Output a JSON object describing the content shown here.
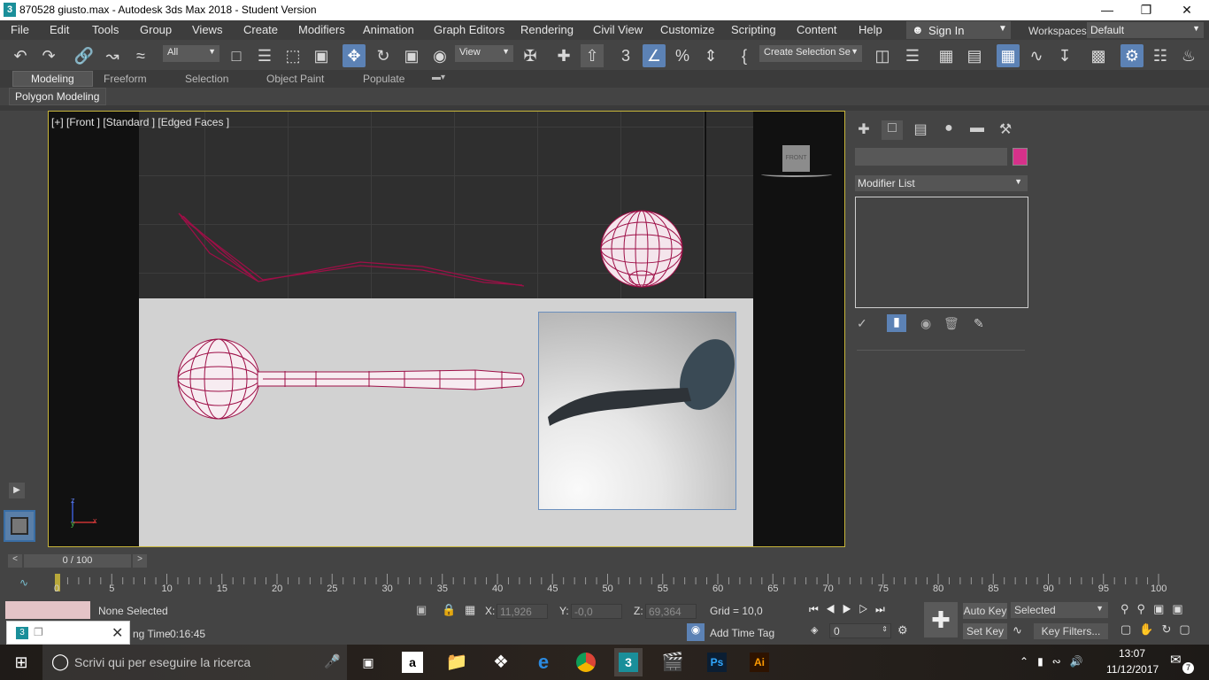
{
  "window": {
    "title": "870528 giusto.max - Autodesk 3ds Max 2018 - Student Version",
    "app_icon": "3",
    "min": "—",
    "restore": "❐",
    "close": "✕"
  },
  "menu": {
    "items": [
      "File",
      "Edit",
      "Tools",
      "Group",
      "Views",
      "Create",
      "Modifiers",
      "Animation",
      "Graph Editors",
      "Rendering",
      "Civil View",
      "Customize",
      "Scripting",
      "Content",
      "Help"
    ],
    "sign_in": "Sign In",
    "workspaces_label": "Workspaces:",
    "workspace_value": "Default"
  },
  "toolbar": {
    "filter_value": "All",
    "refcoord_value": "View",
    "selection_set": "Create Selection Se"
  },
  "ribbon": {
    "tabs": [
      "Modeling",
      "Freeform",
      "Selection",
      "Object Paint",
      "Populate"
    ],
    "sub_panel": "Polygon Modeling"
  },
  "viewport": {
    "label": "[+] [Front ] [Standard ] [Edged Faces ]",
    "viewcube_face": "FRONT",
    "axis_z": "z",
    "axis_x": "x",
    "axis_y": "y",
    "wire_color": "#9e0f47"
  },
  "command_panel": {
    "modifier_list": "Modifier List",
    "object_color": "#d6318a"
  },
  "timeline": {
    "slider_text": "0 / 100",
    "ticks": [
      "0",
      "5",
      "10",
      "15",
      "20",
      "25",
      "30",
      "35",
      "40",
      "45",
      "50",
      "55",
      "60",
      "65",
      "70",
      "75",
      "80",
      "85",
      "90",
      "95",
      "100"
    ]
  },
  "status": {
    "selection": "None Selected",
    "rendering_time_label": "ng Time",
    "rendering_time": "0:16:45",
    "x_label": "X:",
    "x_value": "11,926",
    "y_label": "Y:",
    "y_value": "-0,0",
    "z_label": "Z:",
    "z_value": "69,364",
    "grid": "Grid = 10,0",
    "add_time_tag": "Add Time Tag",
    "auto_key": "Auto Key",
    "set_key": "Set Key",
    "key_mode": "Selected",
    "frame_value": "0",
    "key_filters": "Key Filters..."
  },
  "taskbar": {
    "search_placeholder": "Scrivi qui per eseguire la ricerca",
    "time": "13:07",
    "date": "11/12/2017",
    "notifications": "7",
    "ps_label": "Ps",
    "ai_label": "Ai",
    "max_label": "3"
  }
}
